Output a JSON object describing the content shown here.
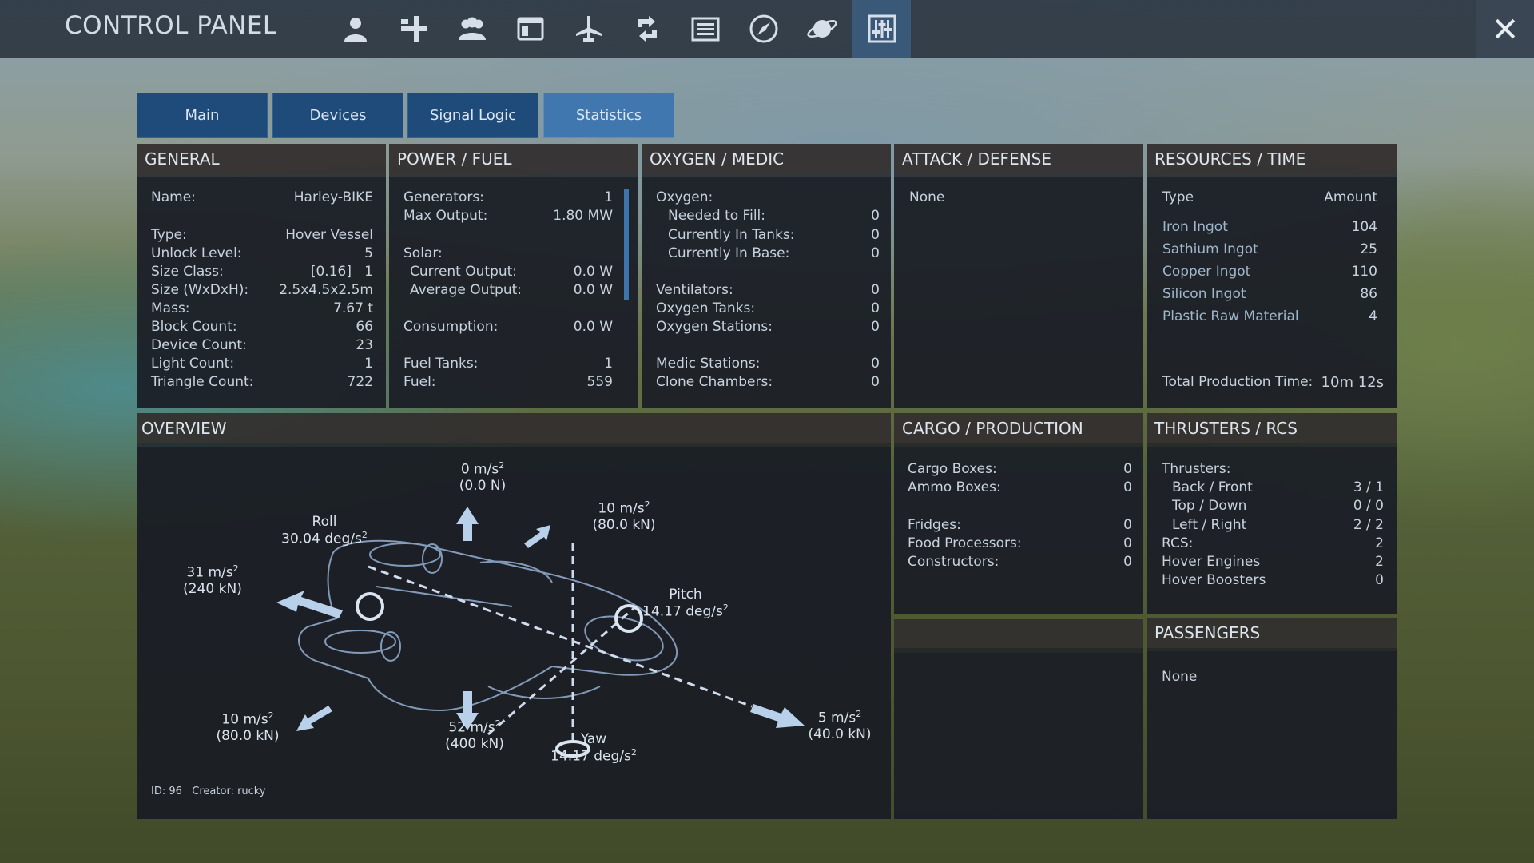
{
  "app": {
    "title": "CONTROL PANEL"
  },
  "nav": {
    "icons": [
      "player-icon",
      "structure-icon",
      "group-icon",
      "window-icon",
      "aircraft-icon",
      "swap-icon",
      "list-icon",
      "compass-icon",
      "planet-icon",
      "control-panel-icon"
    ],
    "active": "control-panel-icon"
  },
  "tabs": [
    {
      "label": "Main"
    },
    {
      "label": "Devices"
    },
    {
      "label": "Signal Logic"
    },
    {
      "label": "Statistics",
      "active": true
    }
  ],
  "general": {
    "title": "GENERAL",
    "rows": [
      {
        "label": "Name:",
        "value": "Harley-BIKE"
      },
      {
        "label": "Type:",
        "value": "Hover Vessel"
      },
      {
        "label": "Unlock Level:",
        "value": "5"
      },
      {
        "label": "Size Class:",
        "value": "[0.16]   1"
      },
      {
        "label": "Size (WxDxH):",
        "value": "2.5x4.5x2.5m"
      },
      {
        "label": "Mass:",
        "value": "7.67 t"
      },
      {
        "label": "Block Count:",
        "value": "66"
      },
      {
        "label": "Device Count:",
        "value": "23"
      },
      {
        "label": "Light Count:",
        "value": "1"
      },
      {
        "label": "Triangle Count:",
        "value": "722"
      }
    ]
  },
  "power": {
    "title": "POWER / FUEL",
    "rows": [
      {
        "label": "Generators:",
        "value": "1"
      },
      {
        "label": "Max Output:",
        "value": "1.80 MW"
      },
      {
        "label": "Solar:",
        "value": ""
      },
      {
        "label": "Current Output:",
        "value": "0.0 W"
      },
      {
        "label": "Average Output:",
        "value": "0.0 W"
      },
      {
        "label": "Consumption:",
        "value": "0.0 W"
      },
      {
        "label": "Fuel Tanks:",
        "value": "1"
      },
      {
        "label": "Fuel:",
        "value": "559"
      }
    ]
  },
  "oxygen": {
    "title": "OXYGEN / MEDIC",
    "rows": [
      {
        "label": "Oxygen:",
        "value": ""
      },
      {
        "label": "Needed to Fill:",
        "value": "0"
      },
      {
        "label": "Currently In Tanks:",
        "value": "0"
      },
      {
        "label": "Currently In Base:",
        "value": "0"
      },
      {
        "label": "Ventilators:",
        "value": "0"
      },
      {
        "label": "Oxygen Tanks:",
        "value": "0"
      },
      {
        "label": "Oxygen Stations:",
        "value": "0"
      },
      {
        "label": "Medic Stations:",
        "value": "0"
      },
      {
        "label": "Clone Chambers:",
        "value": "0"
      }
    ]
  },
  "attack": {
    "title": "ATTACK / DEFENSE",
    "value": "None"
  },
  "resources": {
    "title": "RESOURCES / TIME",
    "col_type": "Type",
    "col_amount": "Amount",
    "items": [
      {
        "name": "Iron Ingot",
        "amount": "104"
      },
      {
        "name": "Sathium Ingot",
        "amount": "25"
      },
      {
        "name": "Copper Ingot",
        "amount": "110"
      },
      {
        "name": "Silicon Ingot",
        "amount": "86"
      },
      {
        "name": "Plastic Raw Material",
        "amount": "4"
      }
    ],
    "total_label": "Total Production Time:",
    "total_value": "10m 12s"
  },
  "overview": {
    "title": "OVERVIEW",
    "up_accel": "0 m/s",
    "up_force": "(0.0 N)",
    "fwd_accel": "10 m/s",
    "fwd_force": "(80.0 kN)",
    "roll_label": "Roll",
    "roll_value": "30.04 deg/s",
    "left_accel": "31 m/s",
    "left_force": "(240 kN)",
    "pitch_label": "Pitch",
    "pitch_value": "14.17 deg/s",
    "back_accel": "10 m/s",
    "back_force": "(80.0 kN)",
    "down_accel": "52 m/s",
    "down_force": "(400 kN)",
    "yaw_label": "Yaw",
    "yaw_value": "14.17 deg/s",
    "right_accel": "5 m/s",
    "right_force": "(40.0 kN)",
    "sq": "2",
    "id_text": "ID: 96   Creator: rucky"
  },
  "cargo": {
    "title": "CARGO / PRODUCTION",
    "rows": [
      {
        "label": "Cargo Boxes:",
        "value": "0"
      },
      {
        "label": "Ammo Boxes:",
        "value": "0"
      },
      {
        "label": "Fridges:",
        "value": "0"
      },
      {
        "label": "Food Processors:",
        "value": "0"
      },
      {
        "label": "Constructors:",
        "value": "0"
      }
    ]
  },
  "thrusters": {
    "title": "THRUSTERS / RCS",
    "rows": [
      {
        "label": "Thrusters:",
        "value": ""
      },
      {
        "label": "Back / Front",
        "value": "3 / 1"
      },
      {
        "label": "Top / Down",
        "value": "0 / 0"
      },
      {
        "label": "Left / Right",
        "value": "2 / 2"
      },
      {
        "label": "RCS:",
        "value": "2"
      },
      {
        "label": "Hover Engines",
        "value": "2"
      },
      {
        "label": "Hover Boosters",
        "value": "0"
      }
    ]
  },
  "passengers": {
    "title": "PASSENGERS",
    "value": "None"
  }
}
